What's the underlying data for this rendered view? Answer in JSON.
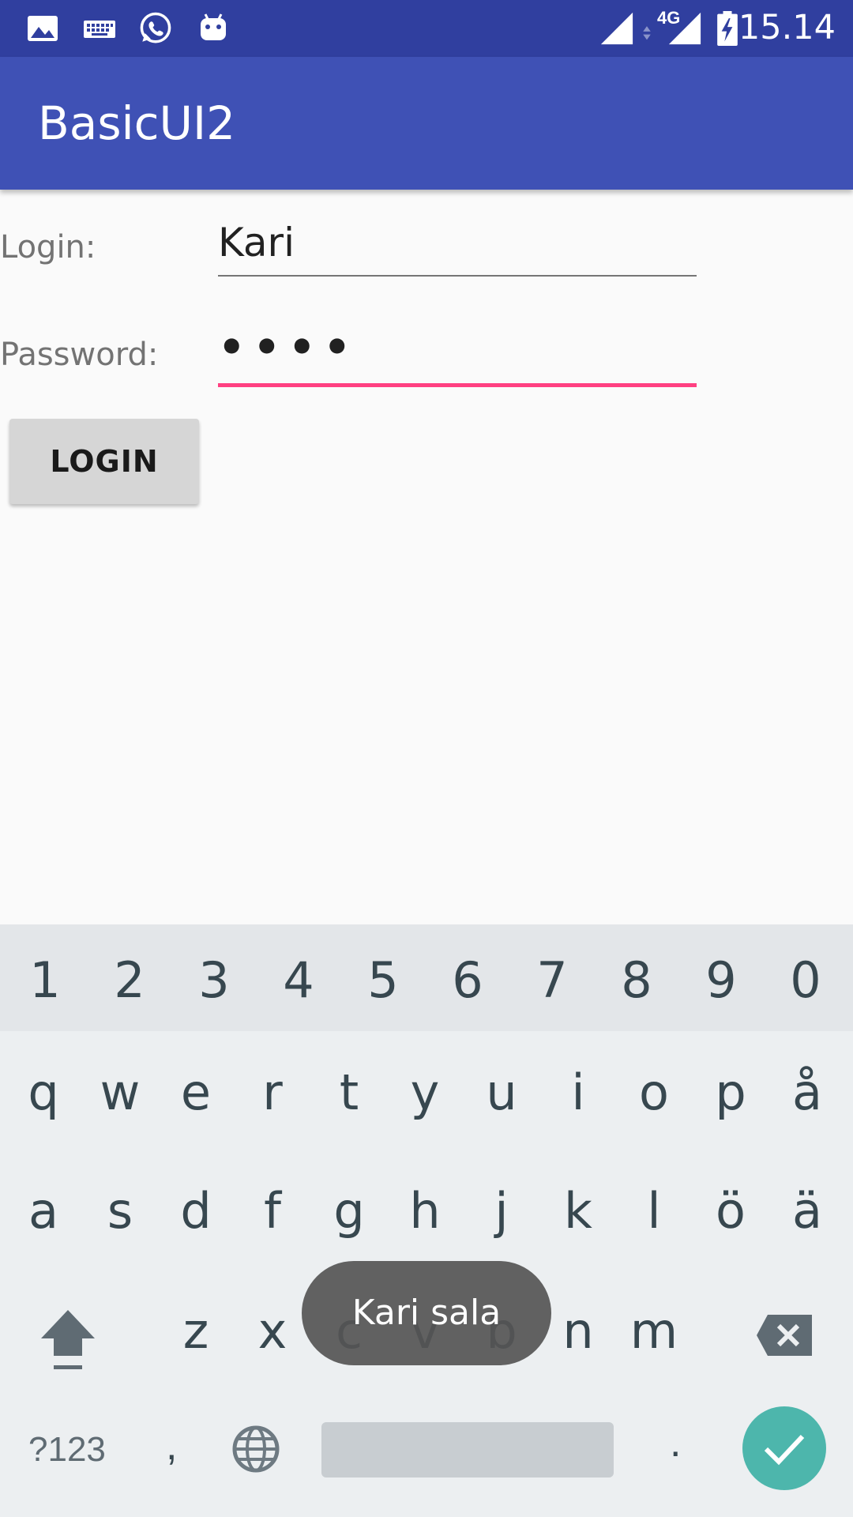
{
  "status_bar": {
    "time": "15.14",
    "network": "4G",
    "icons": [
      "image-icon",
      "keyboard-icon",
      "whatsapp-icon",
      "android-icon",
      "signal-icon",
      "cell-signal-icon",
      "battery-charging-icon"
    ]
  },
  "app_bar": {
    "title": "BasicUI2"
  },
  "form": {
    "login_label": "Login:",
    "login_value": "Kari",
    "password_label": "Password:",
    "password_value": "••••",
    "login_button": "LOGIN"
  },
  "keyboard": {
    "numbers": [
      "1",
      "2",
      "3",
      "4",
      "5",
      "6",
      "7",
      "8",
      "9",
      "0"
    ],
    "row1": [
      "q",
      "w",
      "e",
      "r",
      "t",
      "y",
      "u",
      "i",
      "o",
      "p",
      "å"
    ],
    "row2": [
      "a",
      "s",
      "d",
      "f",
      "g",
      "h",
      "j",
      "k",
      "l",
      "ö",
      "ä"
    ],
    "row3": [
      "z",
      "x",
      "c",
      "v",
      "b",
      "n",
      "m"
    ],
    "symbols_key": "?123",
    "comma_key": ",",
    "period_key": "."
  },
  "toast": {
    "message": "Kari sala"
  },
  "colors": {
    "status_bar": "#303f9f",
    "app_bar": "#3f51b5",
    "accent": "#ff4081",
    "done": "#4db6ac"
  }
}
